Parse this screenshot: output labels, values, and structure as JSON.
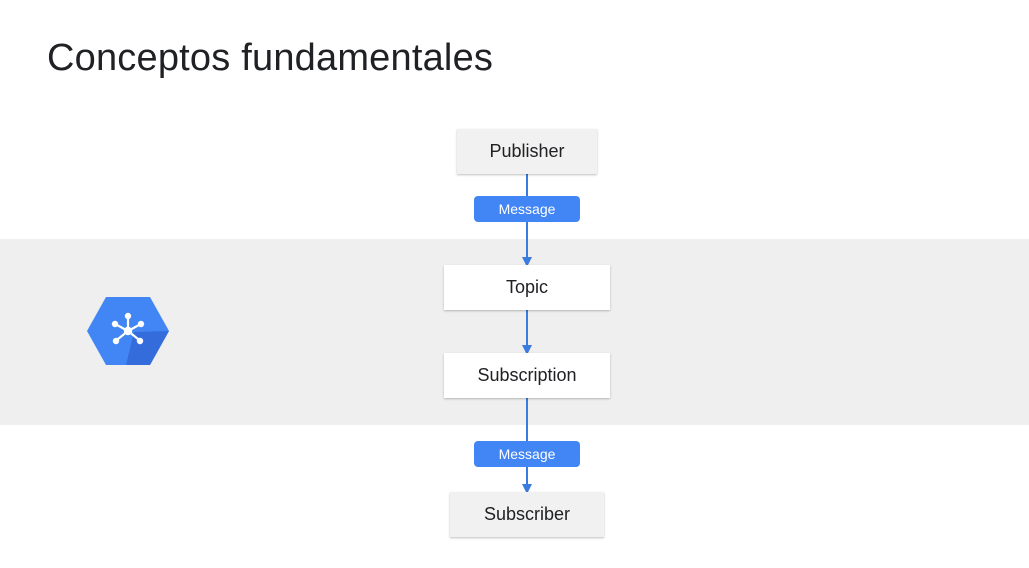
{
  "slide": {
    "title": "Conceptos fundamentales"
  },
  "diagram": {
    "nodes": {
      "publisher": "Publisher",
      "topic": "Topic",
      "subscription": "Subscription",
      "subscriber": "Subscriber"
    },
    "edge_labels": {
      "publish_message": "Message",
      "deliver_message": "Message"
    },
    "colors": {
      "accent": "#4285f4",
      "band": "#efefef",
      "logo_light": "#4285f4",
      "logo_dark": "#3367d6"
    },
    "logo_icon": "pubsub-hexagon-icon"
  }
}
